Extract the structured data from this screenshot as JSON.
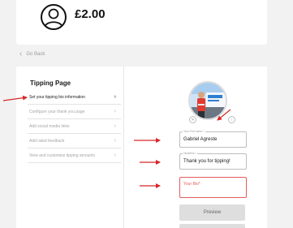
{
  "header": {
    "amount": "£2.00",
    "avatar_icon": "user-avatar-icon"
  },
  "nav": {
    "back_label": "Go Back"
  },
  "sidebar": {
    "title": "Tipping Page",
    "items": [
      {
        "label": "Set your tipping bio information",
        "active": true
      },
      {
        "label": "Configure your thank you page",
        "active": false
      },
      {
        "label": "Add social media links",
        "active": false
      },
      {
        "label": "Add rated feedback",
        "active": false
      },
      {
        "label": "View and customise tipping amounts",
        "active": false
      }
    ]
  },
  "form": {
    "name_label": "Your Full name *",
    "name_value": "Gabriel Agreste",
    "headline_label": "Headline *",
    "headline_value": "Thank you for tipping!",
    "bio_label": "Your Bio*",
    "bio_value": "",
    "preview_label": "Preview"
  },
  "colors": {
    "annotation_arrow": "#d62828",
    "error": "#e35b5b",
    "background": "#f2f2f2"
  }
}
